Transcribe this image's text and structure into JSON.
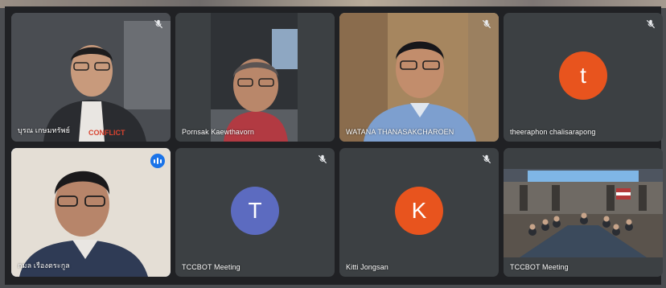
{
  "tiles": [
    {
      "name": "บุรณ เกษมทรัพย์",
      "mic_muted": true,
      "kind": "video"
    },
    {
      "name": "Pornsak Kaewthavorn",
      "mic_muted": false,
      "kind": "video"
    },
    {
      "name": "WATANA THANASAKCHAROEN",
      "mic_muted": true,
      "kind": "video"
    },
    {
      "name": "theeraphon chalisarapong",
      "mic_muted": true,
      "kind": "avatar",
      "initial": "t",
      "avatar_color": "#e8541e"
    },
    {
      "name": "กมล เรืองตระกูล",
      "mic_muted": false,
      "speaking": true,
      "kind": "video"
    },
    {
      "name": "TCCBOT Meeting",
      "mic_muted": true,
      "kind": "avatar",
      "initial": "T",
      "avatar_color": "#5c6bc0"
    },
    {
      "name": "Kitti Jongsan",
      "mic_muted": true,
      "kind": "avatar",
      "initial": "K",
      "avatar_color": "#e8541e"
    },
    {
      "name": "TCCBOT Meeting",
      "mic_muted": false,
      "kind": "video"
    }
  ],
  "shirt_text": "CONFLICT",
  "icons": {
    "muted": "mic-off-icon",
    "speaking": "audio-level-icon"
  },
  "colors": {
    "speaking_outline": "#8ab4f8",
    "tile_bg": "#3c4043",
    "stage_bg": "#202124"
  }
}
